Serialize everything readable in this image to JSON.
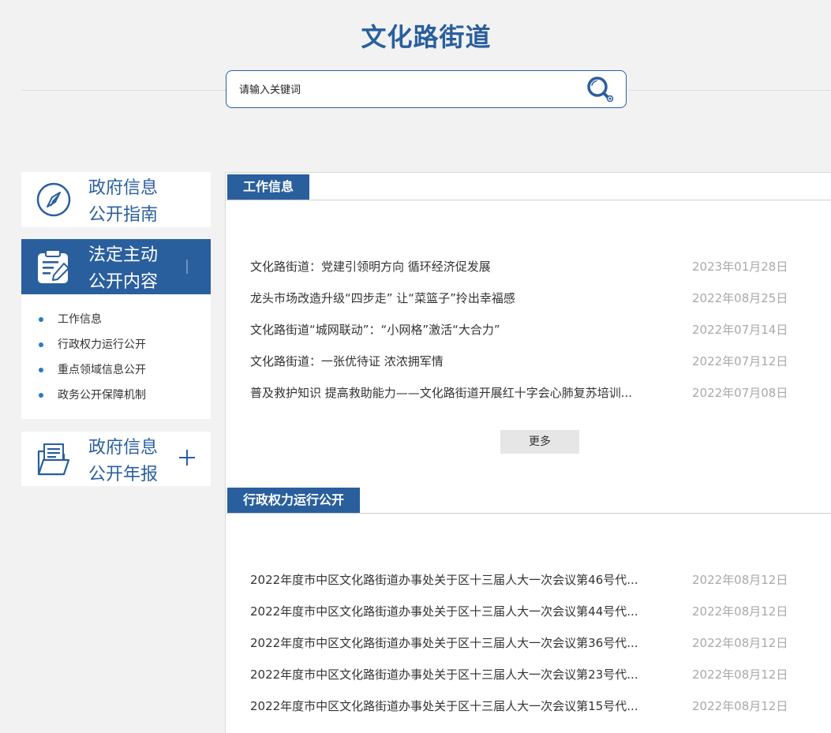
{
  "site": {
    "title": "文化路街道"
  },
  "search": {
    "placeholder": "请输入关键词"
  },
  "sidebar": {
    "guide": {
      "line1": "政府信息",
      "line2": "公开指南"
    },
    "active": {
      "line1": "法定主动",
      "line2": "公开内容"
    },
    "submenu": [
      "工作信息",
      "行政权力运行公开",
      "重点领域信息公开",
      "政务公开保障机制"
    ],
    "annual": {
      "line1": "政府信息",
      "line2": "公开年报"
    }
  },
  "sections": [
    {
      "title": "工作信息",
      "items": [
        {
          "title": "文化路街道：党建引领明方向 循环经济促发展",
          "date": "2023年01月28日"
        },
        {
          "title": "龙头市场改造升级“四步走” 让“菜篮子”拎出幸福感",
          "date": "2022年08月25日"
        },
        {
          "title": "文化路街道“城网联动”：“小网格”激活“大合力”",
          "date": "2022年07月14日"
        },
        {
          "title": "文化路街道：一张优待证 浓浓拥军情",
          "date": "2022年07月12日"
        },
        {
          "title": "普及救护知识 提高救助能力——文化路街道开展红十字会心肺复苏培训...",
          "date": "2022年07月08日"
        }
      ],
      "more_label": "更多"
    },
    {
      "title": "行政权力运行公开",
      "items": [
        {
          "title": "2022年度市中区文化路街道办事处关于区十三届人大一次会议第46号代...",
          "date": "2022年08月12日"
        },
        {
          "title": "2022年度市中区文化路街道办事处关于区十三届人大一次会议第44号代...",
          "date": "2022年08月12日"
        },
        {
          "title": "2022年度市中区文化路街道办事处关于区十三届人大一次会议第36号代...",
          "date": "2022年08月12日"
        },
        {
          "title": "2022年度市中区文化路街道办事处关于区十三届人大一次会议第23号代...",
          "date": "2022年08月12日"
        },
        {
          "title": "2022年度市中区文化路街道办事处关于区十三届人大一次会议第15号代...",
          "date": "2022年08月12日"
        }
      ]
    }
  ],
  "icons": {
    "guide": "compass-icon",
    "active": "clipboard-edit-icon",
    "annual": "folder-document-icon",
    "expand": "plus-icon",
    "search": "magnifier-icon"
  },
  "colors": {
    "brand": "#2a5f9e",
    "background": "#f2f2f2",
    "date": "#a9a9a9",
    "bullet": "#2a78c8"
  }
}
